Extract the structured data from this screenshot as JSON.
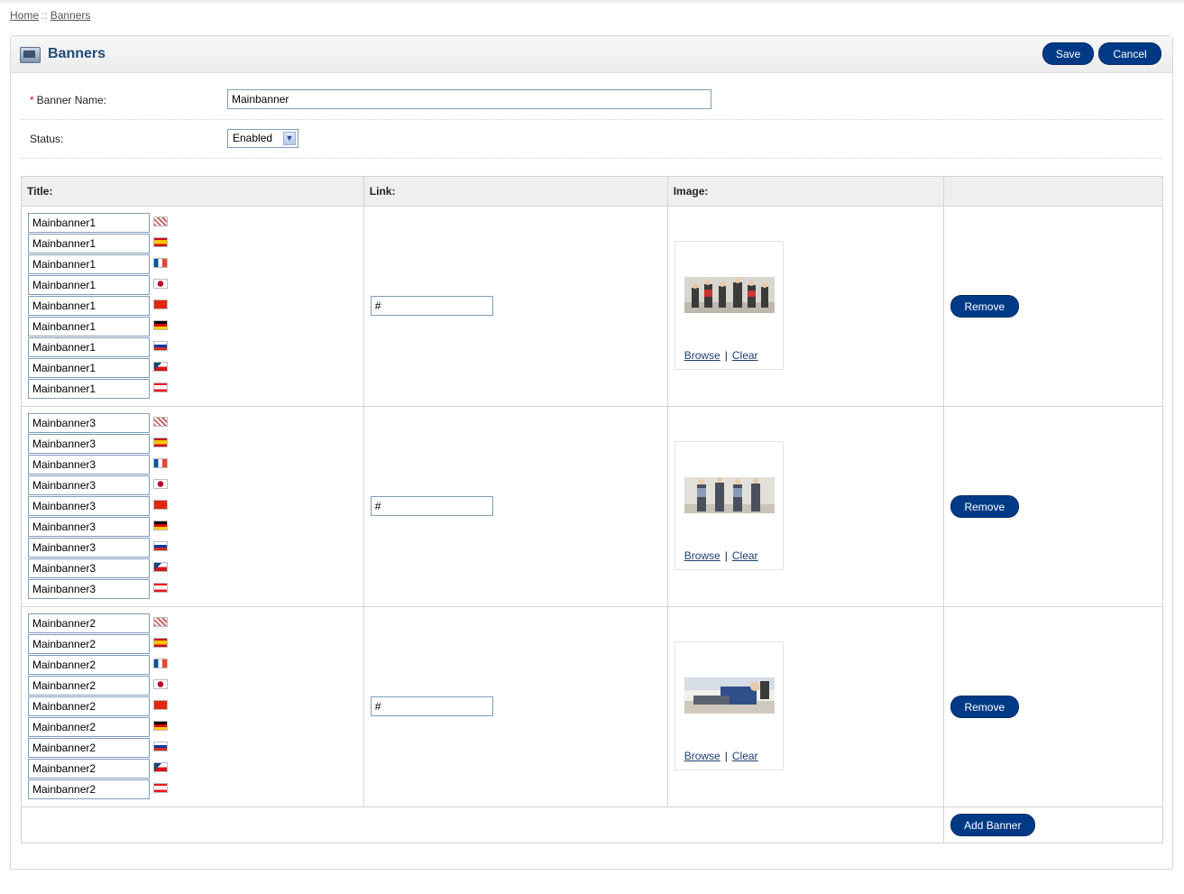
{
  "breadcrumb": {
    "home": "Home",
    "separator": "::",
    "current": "Banners"
  },
  "page": {
    "title": "Banners",
    "icon": "banner-icon"
  },
  "buttons": {
    "save": "Save",
    "cancel": "Cancel",
    "remove": "Remove",
    "add_banner": "Add Banner"
  },
  "form": {
    "banner_name_label": "Banner Name:",
    "required_marker": "*",
    "banner_name_value": "Mainbanner",
    "status_label": "Status:",
    "status_value": "Enabled"
  },
  "table": {
    "headers": {
      "title": "Title:",
      "link": "Link:",
      "image": "Image:"
    },
    "rows": [
      {
        "titles": [
          "Mainbanner1",
          "Mainbanner1",
          "Mainbanner1",
          "Mainbanner1",
          "Mainbanner1",
          "Mainbanner1",
          "Mainbanner1",
          "Mainbanner1",
          "Mainbanner1"
        ],
        "link": "#",
        "browse": "Browse",
        "separator": "|",
        "clear": "Clear"
      },
      {
        "titles": [
          "Mainbanner3",
          "Mainbanner3",
          "Mainbanner3",
          "Mainbanner3",
          "Mainbanner3",
          "Mainbanner3",
          "Mainbanner3",
          "Mainbanner3",
          "Mainbanner3"
        ],
        "link": "#",
        "browse": "Browse",
        "separator": "|",
        "clear": "Clear"
      },
      {
        "titles": [
          "Mainbanner2",
          "Mainbanner2",
          "Mainbanner2",
          "Mainbanner2",
          "Mainbanner2",
          "Mainbanner2",
          "Mainbanner2",
          "Mainbanner2",
          "Mainbanner2"
        ],
        "link": "#",
        "browse": "Browse",
        "separator": "|",
        "clear": "Clear"
      }
    ]
  },
  "languages": [
    "english",
    "spanish",
    "french",
    "japanese",
    "chinese",
    "german",
    "russian",
    "czech",
    "lebanese"
  ],
  "colors": {
    "accent": "#003a87",
    "heading_text": "#1e4a7a",
    "required": "#ee0000"
  }
}
